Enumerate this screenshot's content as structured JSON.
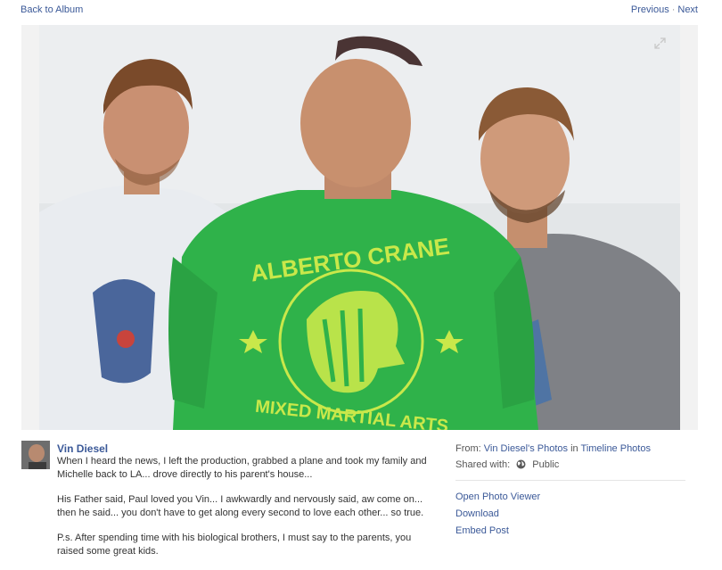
{
  "nav": {
    "back_label": "Back to Album",
    "previous_label": "Previous",
    "separator": "·",
    "next_label": "Next"
  },
  "photo": {
    "shirt_text_top": "ALBERTO CRANE",
    "shirt_text_bottom": "MIXED MARTIAL ARTS",
    "expand_icon": "expand-icon"
  },
  "post": {
    "author": "Vin Diesel",
    "paragraphs": [
      "When I heard the news, I left the production, grabbed a plane and took my family and Michelle back to LA... drove directly to his parent's house...",
      "His Father said, Paul loved you Vin... I awkwardly and nervously said, aw come on... then he said... you don't have to get along every second to love each other... so true.",
      "P.s. After spending time with his biological brothers, I must say to the parents, you raised some great kids."
    ]
  },
  "meta": {
    "from_label": "From:",
    "from_link": "Vin Diesel's Photos",
    "in_word": "in",
    "album_link": "Timeline Photos",
    "shared_label": "Shared with:",
    "privacy": "Public"
  },
  "actions": {
    "open_viewer": "Open Photo Viewer",
    "download": "Download",
    "embed": "Embed Post"
  },
  "colors": {
    "link": "#3b5998",
    "shirt_green": "#2fb24a",
    "logo_yellow": "#c9e84a"
  }
}
